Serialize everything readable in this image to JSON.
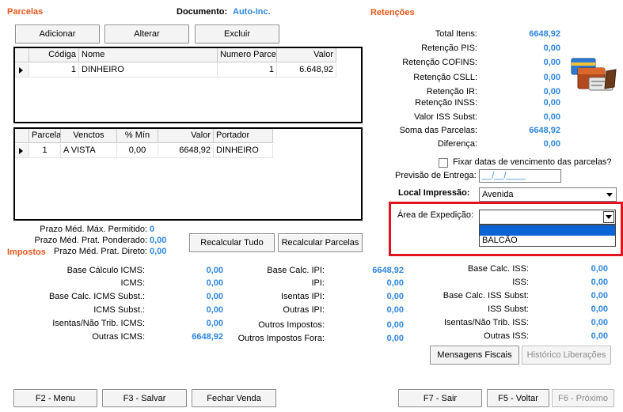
{
  "parcelas": {
    "title": "Parcelas",
    "documento_label": "Documento:",
    "documento_value": "Auto-Inc.",
    "buttons": {
      "adicionar": "Adicionar",
      "alterar": "Alterar",
      "excluir": "Excluir"
    },
    "grid1": {
      "headers": [
        "Códiga",
        "Nome",
        "Numero Parcel",
        "Valor"
      ],
      "rows": [
        {
          "codigo": "1",
          "nome": "DINHEIRO",
          "numero": "1",
          "valor": "6.648,92"
        }
      ]
    },
    "grid2": {
      "headers": [
        "Parcela",
        "Venctos",
        "% Mín",
        "Valor",
        "Portador"
      ],
      "rows": [
        {
          "parcela": "1",
          "venctos": "A VISTA",
          "pct": "0,00",
          "valor": "6648,92",
          "portador": "DINHEIRO"
        }
      ]
    },
    "prazo": [
      {
        "label": "Prazo Méd. Máx. Permitido:",
        "value": "0"
      },
      {
        "label": "Prazo Méd. Prat. Ponderado:",
        "value": "0,00"
      },
      {
        "label": "Prazo Méd. Prat. Direto:",
        "value": "0,00"
      }
    ],
    "recalcular_tudo": "Recalcular Tudo",
    "recalcular_parcelas": "Recalcular Parcelas"
  },
  "retencoes": {
    "title": "Retenções",
    "items": [
      {
        "label": "Total Itens:",
        "value": "6648,92"
      },
      {
        "label": "Retenção PIS:",
        "value": "0,00"
      },
      {
        "label": "Retenção COFINS:",
        "value": "0,00"
      },
      {
        "label": "Retenção CSLL:",
        "value": "0,00"
      },
      {
        "label": "Retenção IR:",
        "value": "0,00"
      },
      {
        "label": "Retenção INSS:",
        "value": "0,00"
      },
      {
        "label": "Valor ISS Subst:",
        "value": "0,00"
      },
      {
        "label": "Soma das Parcelas:",
        "value": "6648,92"
      },
      {
        "label": "Diferença:",
        "value": "0,00"
      }
    ],
    "fixar_label": "Fixar datas de vencimento das parcelas?",
    "previsao_label": "Previsão de Entrega:",
    "previsao_value": "__/__/____",
    "local_label": "Local Impressão:",
    "local_value": "Avenida",
    "area_label": "Área de Expedição:",
    "area_value": "",
    "area_options": [
      "",
      "BALCÃO"
    ]
  },
  "impostos": {
    "title": "Impostos",
    "col1": [
      {
        "label": "Base Cálculo ICMS:",
        "value": "0,00"
      },
      {
        "label": "ICMS:",
        "value": "0,00"
      },
      {
        "label": "Base Calc. ICMS Subst.:",
        "value": "0,00"
      },
      {
        "label": "ICMS Subst.:",
        "value": "0,00"
      },
      {
        "label": "Isentas/Não Trib. ICMS:",
        "value": "0,00"
      },
      {
        "label": "Outras ICMS:",
        "value": "6648,92"
      }
    ],
    "col2": [
      {
        "label": "Base Calc. IPI:",
        "value": "6648,92"
      },
      {
        "label": "IPI:",
        "value": "0,00"
      },
      {
        "label": "Isentas IPI:",
        "value": "0,00"
      },
      {
        "label": "Outras IPI:",
        "value": "0,00"
      },
      {
        "label": "Outros Impostos:",
        "value": "0,00"
      },
      {
        "label": "Outros Impostos Fora:",
        "value": "0,00"
      }
    ],
    "col3": [
      {
        "label": "Base Calc. ISS:",
        "value": "0,00"
      },
      {
        "label": "ISS:",
        "value": "0,00"
      },
      {
        "label": "Base Calc. ISS Subst:",
        "value": "0,00"
      },
      {
        "label": "ISS Subst:",
        "value": "0,00"
      },
      {
        "label": "Isentas/Não Trib. ISS:",
        "value": "0,00"
      },
      {
        "label": "Outras ISS:",
        "value": "0,00"
      }
    ],
    "mensagens_fiscais": "Mensagens Fiscais",
    "historico_liberacoes": "Histórico Liberações"
  },
  "footer": {
    "f2": "F2 - Menu",
    "f3": "F3 - Salvar",
    "fechar": "Fechar Venda",
    "f7": "F7 - Sair",
    "f5": "F5 - Voltar",
    "f6": "F6 - Próximo"
  },
  "colors": {
    "accent": "#e8561c",
    "value_blue": "#2e86de",
    "highlight": "#e0141e",
    "selection": "#0a64d6"
  }
}
